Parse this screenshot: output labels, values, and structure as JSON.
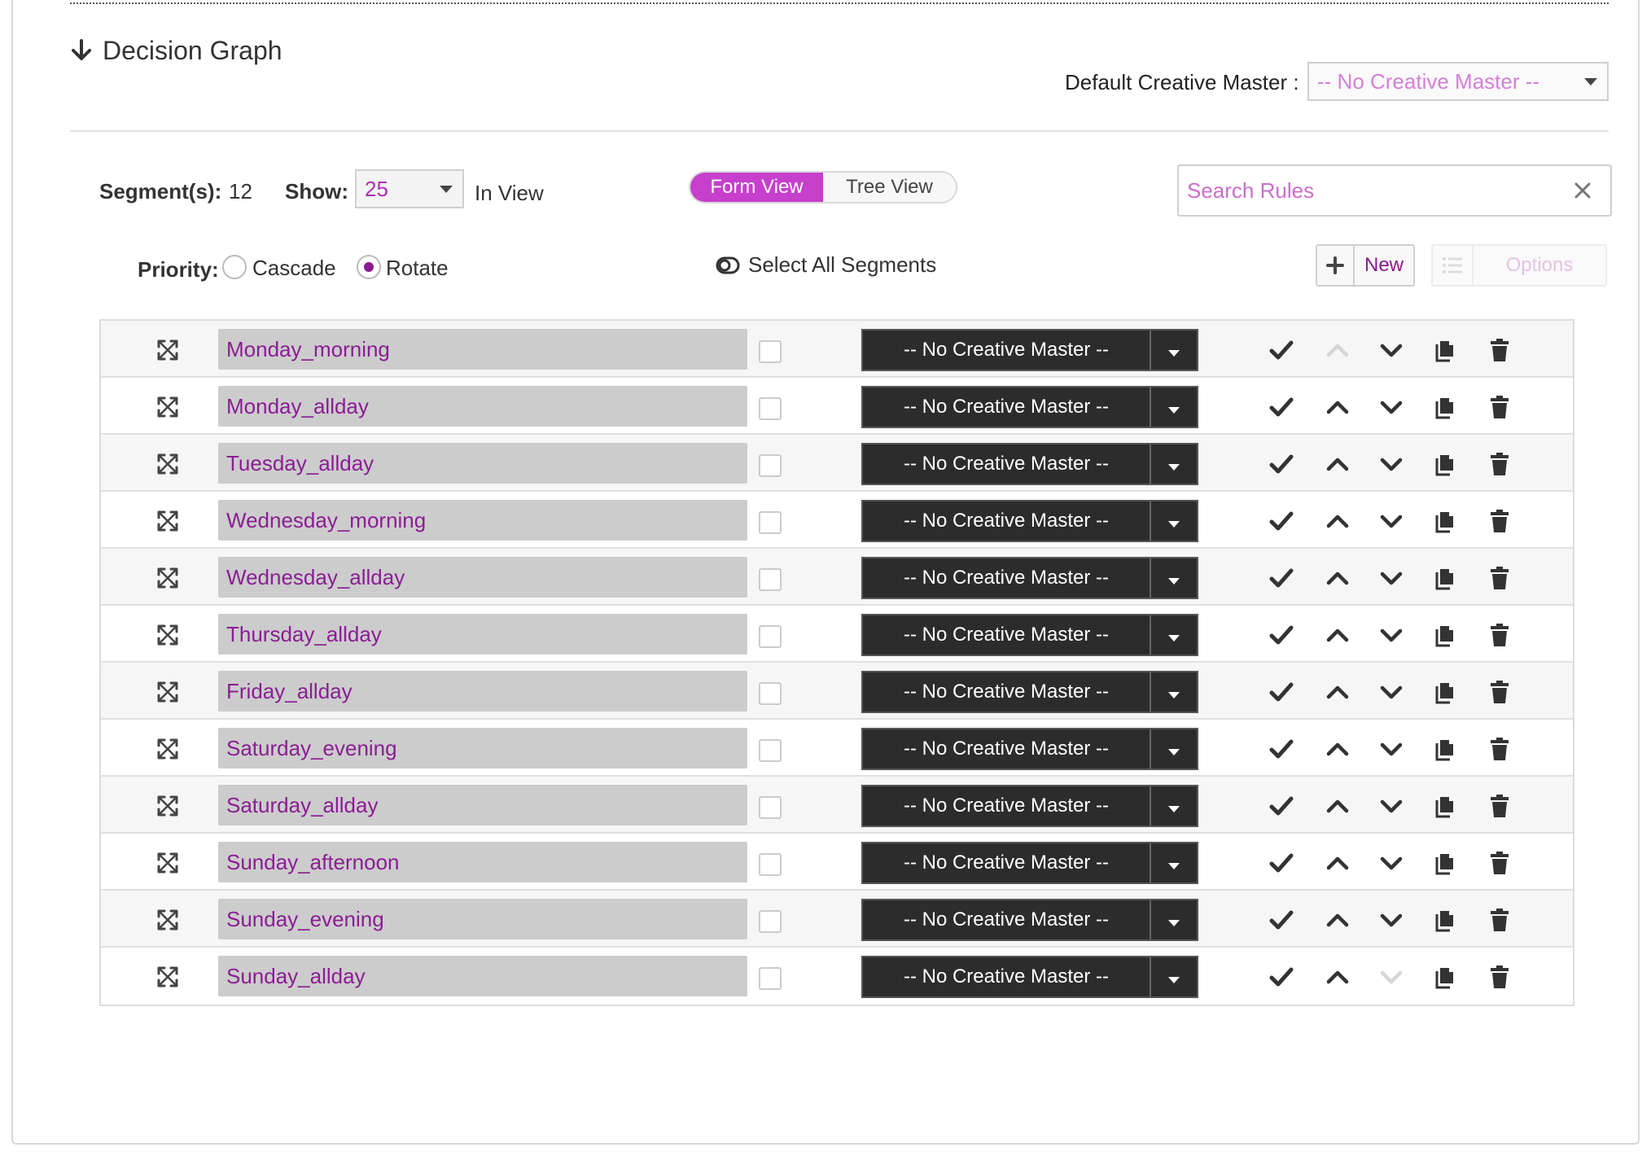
{
  "header": {
    "title": "Decision Graph",
    "default_cm_label": "Default Creative Master :",
    "default_cm_value": "-- No Creative Master --"
  },
  "toolbar": {
    "segments_label": "Segment(s):",
    "segments_count": "12",
    "show_label": "Show:",
    "show_value": "25",
    "in_view": "In View",
    "view_toggle": {
      "form": "Form View",
      "tree": "Tree View",
      "active": "form"
    },
    "search_placeholder": "Search Rules",
    "priority_label": "Priority:",
    "priority_options": [
      "Cascade",
      "Rotate"
    ],
    "priority_selected": "Rotate",
    "select_all": "Select All Segments",
    "new_label": "New",
    "options_label": "Options"
  },
  "colors": {
    "accent": "#c63fcd",
    "segment_text": "#8b1d94",
    "creative_master_bg": "#2c2c2c"
  },
  "segments": [
    {
      "name": "Monday_morning",
      "creative_master": "-- No Creative Master --",
      "up_disabled": true,
      "down_disabled": false
    },
    {
      "name": "Monday_allday",
      "creative_master": "-- No Creative Master --",
      "up_disabled": false,
      "down_disabled": false
    },
    {
      "name": "Tuesday_allday",
      "creative_master": "-- No Creative Master --",
      "up_disabled": false,
      "down_disabled": false
    },
    {
      "name": "Wednesday_morning",
      "creative_master": "-- No Creative Master --",
      "up_disabled": false,
      "down_disabled": false
    },
    {
      "name": "Wednesday_allday",
      "creative_master": "-- No Creative Master --",
      "up_disabled": false,
      "down_disabled": false
    },
    {
      "name": "Thursday_allday",
      "creative_master": "-- No Creative Master --",
      "up_disabled": false,
      "down_disabled": false
    },
    {
      "name": "Friday_allday",
      "creative_master": "-- No Creative Master --",
      "up_disabled": false,
      "down_disabled": false
    },
    {
      "name": "Saturday_evening",
      "creative_master": "-- No Creative Master --",
      "up_disabled": false,
      "down_disabled": false
    },
    {
      "name": "Saturday_allday",
      "creative_master": "-- No Creative Master --",
      "up_disabled": false,
      "down_disabled": false
    },
    {
      "name": "Sunday_afternoon",
      "creative_master": "-- No Creative Master --",
      "up_disabled": false,
      "down_disabled": false
    },
    {
      "name": "Sunday_evening",
      "creative_master": "-- No Creative Master --",
      "up_disabled": false,
      "down_disabled": false
    },
    {
      "name": "Sunday_allday",
      "creative_master": "-- No Creative Master --",
      "up_disabled": false,
      "down_disabled": true
    }
  ]
}
